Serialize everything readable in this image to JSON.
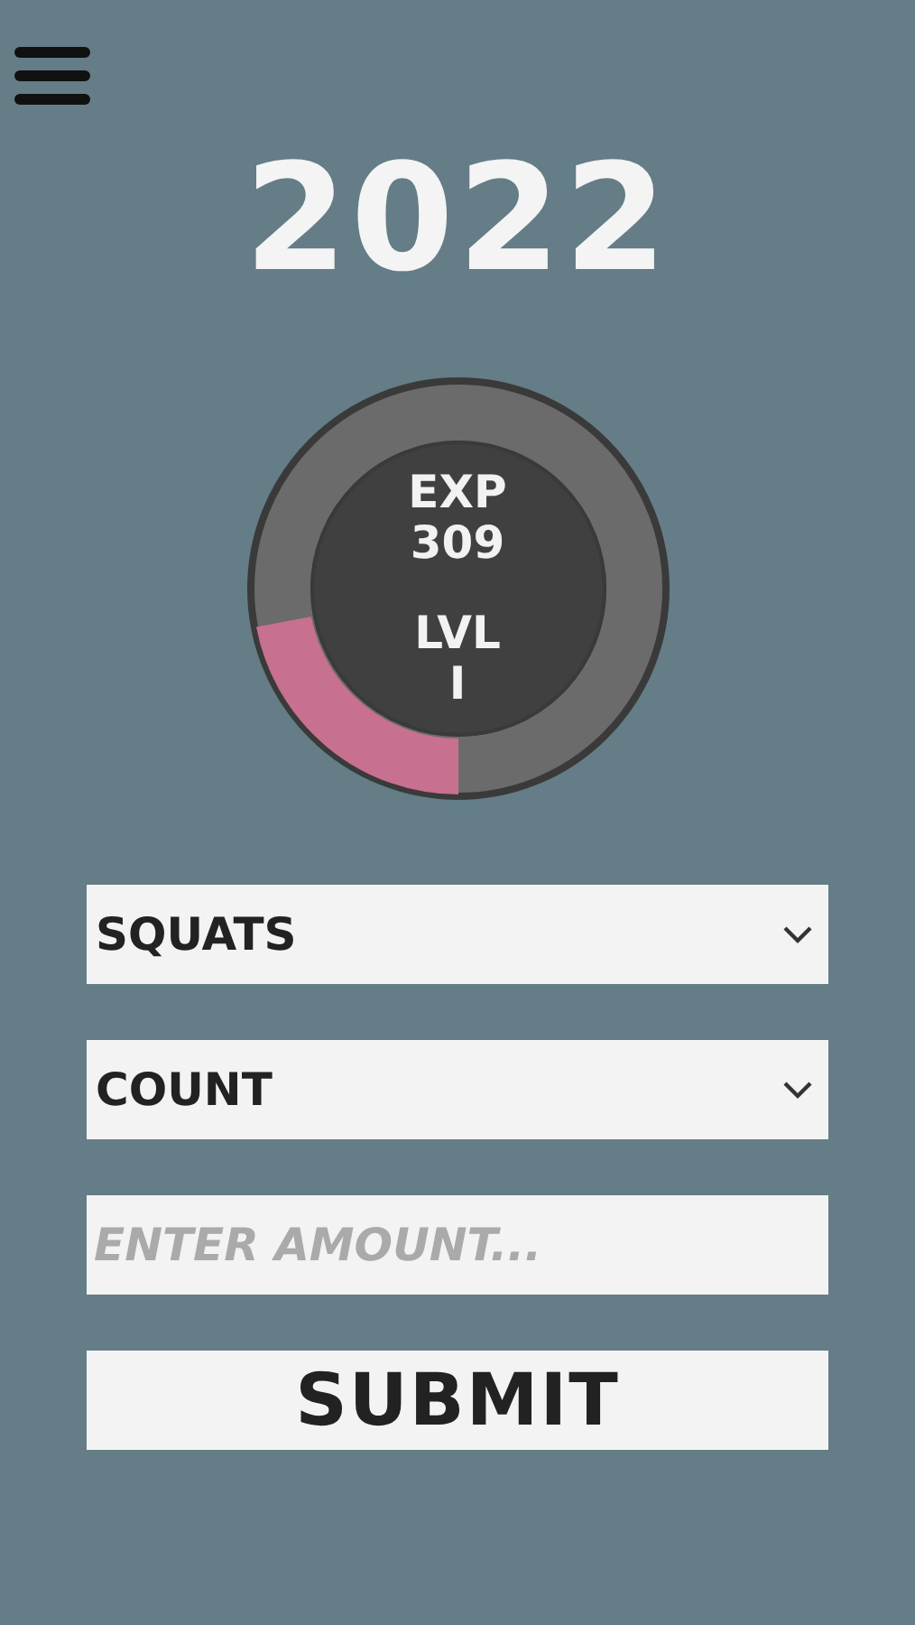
{
  "title": "2022",
  "progress": {
    "exp_label": "EXP",
    "exp_value": "309",
    "level_label": "LVL",
    "level_value": "I",
    "level": 0.22
  },
  "fields": [
    {
      "kind": "select",
      "value": "SQUATS"
    },
    {
      "kind": "select",
      "value": "COUNT"
    },
    {
      "kind": "input",
      "placeholder": "ENTER AMOUNT..."
    }
  ],
  "submit": "SUBMIT"
}
